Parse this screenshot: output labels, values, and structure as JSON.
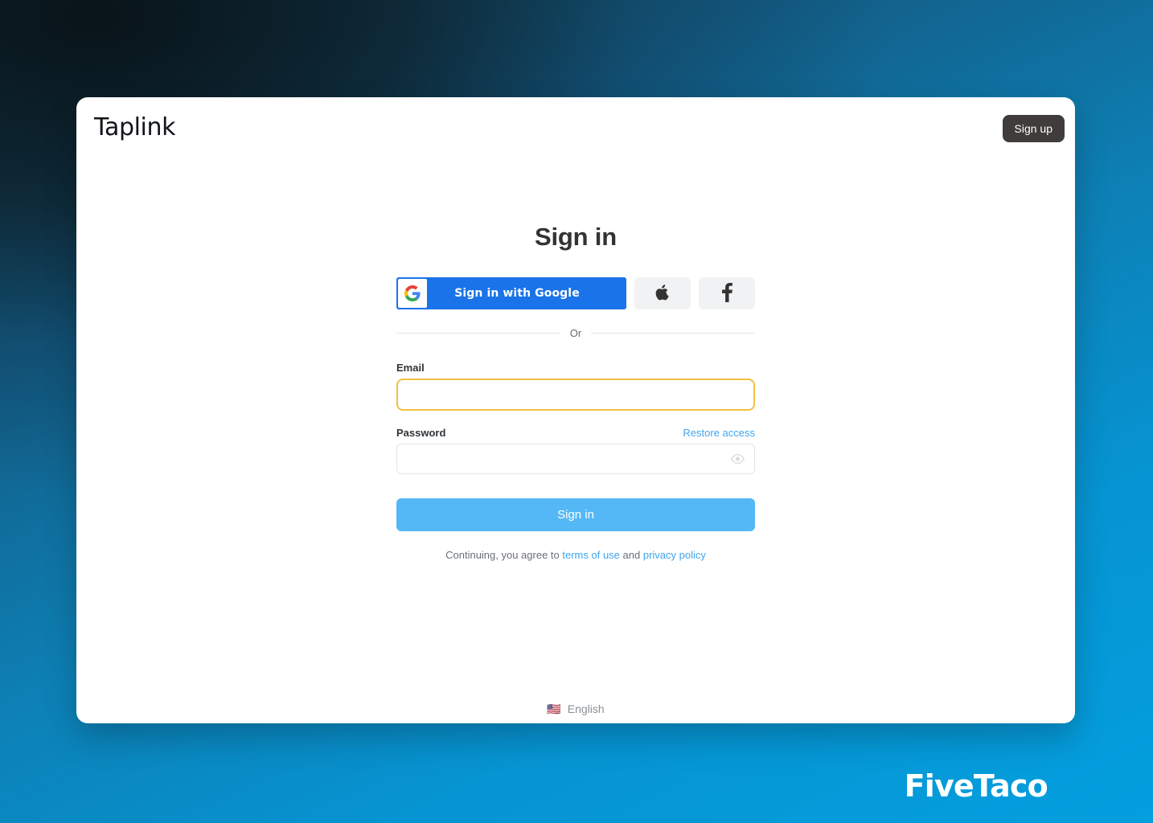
{
  "background": {
    "gradient_dark": "#0b161c",
    "gradient_mid": "#15618e",
    "gradient_bright": "#06a0e0"
  },
  "watermark": {
    "text": "FiveTaco",
    "color": "#ffffff"
  },
  "card": {
    "header": {
      "brand": "Taplink",
      "signup_label": "Sign up",
      "signup_bg": "#3f3c3b"
    },
    "title": "Sign in",
    "social": {
      "google_label": "Sign in with Google",
      "google_bg": "#1a73e8",
      "google_icon": "google-g-icon",
      "apple_icon": "apple-icon",
      "facebook_icon": "facebook-f-icon",
      "button_bg": "#f1f2f3"
    },
    "divider_text": "Or",
    "fields": {
      "email": {
        "label": "Email",
        "value": "",
        "placeholder": "",
        "focused": true,
        "focus_border": "#f5bf3f"
      },
      "password": {
        "label": "Password",
        "value": "",
        "placeholder": "",
        "restore_label": "Restore access",
        "toggle_icon": "eye-icon"
      }
    },
    "submit": {
      "label": "Sign in",
      "color": "#54b8f7"
    },
    "terms": {
      "prefix": "Continuing, you agree to ",
      "terms_link": "terms of use",
      "middle": " and ",
      "privacy_link": "privacy policy",
      "link_color": "#41a6f0"
    },
    "footer": {
      "flag": "🇺🇸",
      "language": "English"
    }
  }
}
